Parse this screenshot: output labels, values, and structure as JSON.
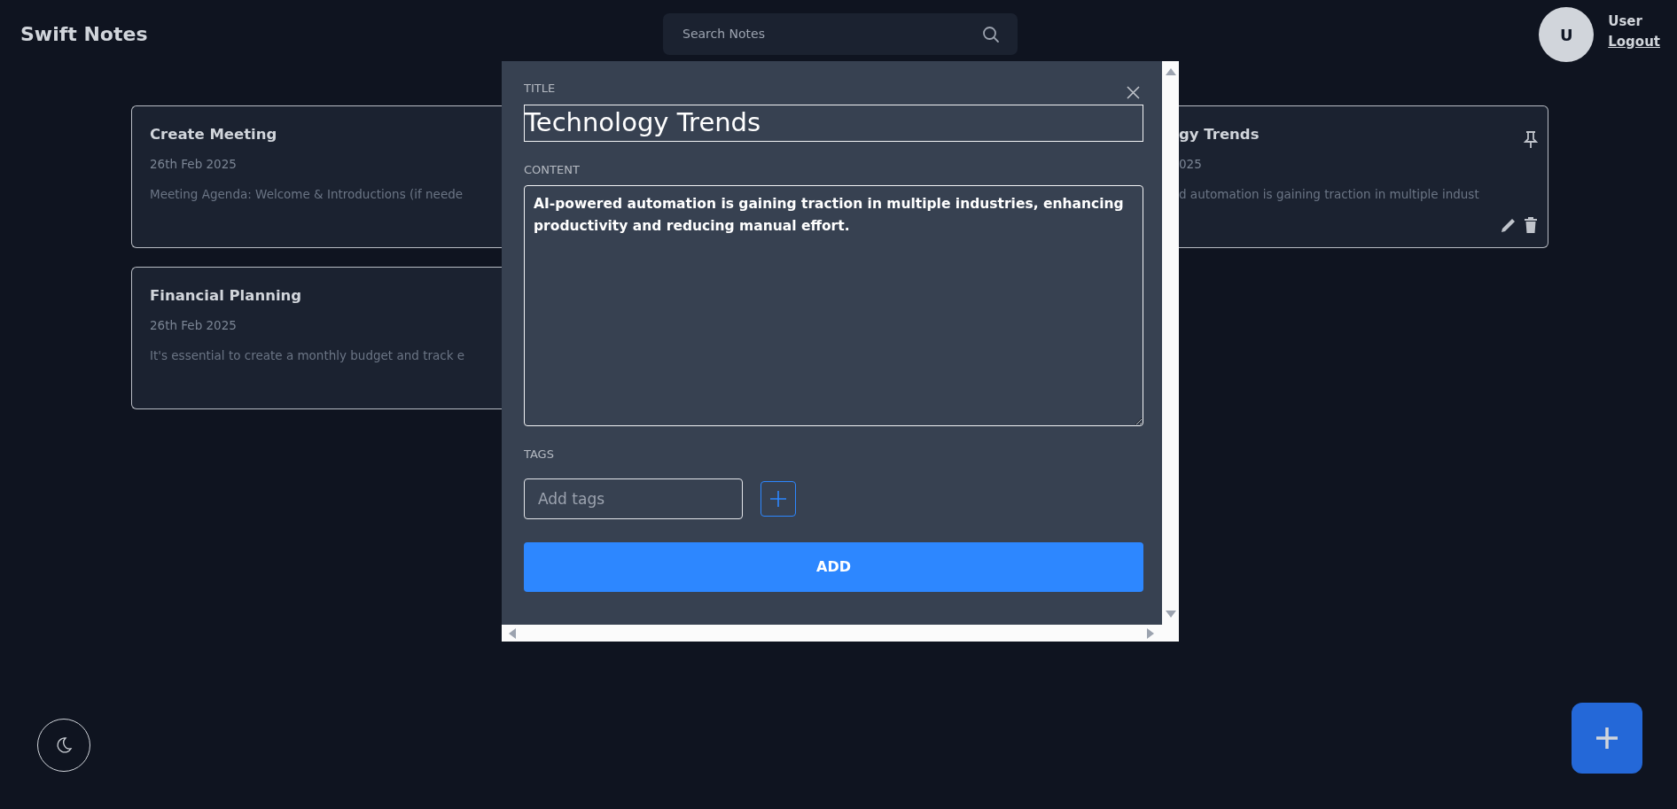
{
  "app": {
    "title": "Swift Notes"
  },
  "search": {
    "placeholder": "Search Notes"
  },
  "user": {
    "initial": "U",
    "name": "User",
    "logout": "Logout"
  },
  "notes": [
    {
      "title": "Create Meeting",
      "date": "26th Feb 2025",
      "content": "Meeting Agenda: Welcome & Introductions (if neede",
      "right_edge_hidden": true
    },
    {
      "title": "Financial Planning",
      "date": "26th Feb 2025",
      "content": "It's essential to create a monthly budget and track e",
      "right_edge_hidden": true
    },
    {
      "title": "gy Trends",
      "date": "025",
      "content": "d automation is gaining traction in multiple indust",
      "right_edge_hidden": false
    }
  ],
  "modal": {
    "title_label": "TITLE",
    "title_value": "Technology Trends",
    "content_label": "CONTENT",
    "content_value": "AI-powered automation is gaining traction in multiple industries, enhancing productivity and reducing manual effort.",
    "tags_label": "TAGS",
    "tags_placeholder": "Add tags",
    "submit": "ADD"
  }
}
